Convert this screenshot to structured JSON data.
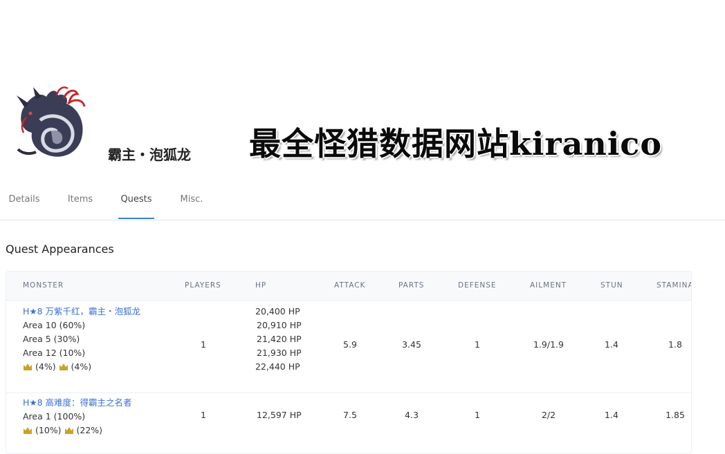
{
  "header": {
    "monster_name": "霸主・泡狐龙",
    "banner_text": "最全怪猎数据网站kiranico"
  },
  "tabs": [
    {
      "label": "Details",
      "active": false
    },
    {
      "label": "Items",
      "active": false
    },
    {
      "label": "Quests",
      "active": true
    },
    {
      "label": "Misc.",
      "active": false
    }
  ],
  "section": {
    "title": "Quest Appearances"
  },
  "table": {
    "columns": [
      "MONSTER",
      "PLAYERS",
      "HP",
      "ATTACK",
      "PARTS",
      "DEFENSE",
      "AILMENT",
      "STUN",
      "STAMINA"
    ],
    "rows": [
      {
        "quest": "H★8 万紫千红，霸主・泡狐龙",
        "areas": [
          "Area 10 (60%)",
          "Area 5 (30%)",
          "Area 12 (10%)"
        ],
        "crown_small": "(4%)",
        "crown_large": "(4%)",
        "players": "1",
        "hp": [
          "20,400 HP",
          "20,910 HP",
          "21,420 HP",
          "21,930 HP",
          "22,440 HP"
        ],
        "attack": "5.9",
        "parts": "3.45",
        "defense": "1",
        "ailment": "1.9/1.9",
        "stun": "1.4",
        "stamina": "1.8"
      },
      {
        "quest": "H★8 高难度：得霸主之名者",
        "areas": [
          "Area 1 (100%)"
        ],
        "crown_small": "(10%)",
        "crown_large": "(22%)",
        "players": "1",
        "hp": [
          "12,597 HP"
        ],
        "attack": "7.5",
        "parts": "4.3",
        "defense": "1",
        "ailment": "2/2",
        "stun": "1.4",
        "stamina": "1.85"
      }
    ]
  },
  "colors": {
    "link": "#3b6fd6",
    "tab_indicator": "#3b7fd6",
    "crown": "#c9a227"
  },
  "icons": {
    "monster": "mizutsune-monster-icon",
    "crown": "crown-icon"
  }
}
